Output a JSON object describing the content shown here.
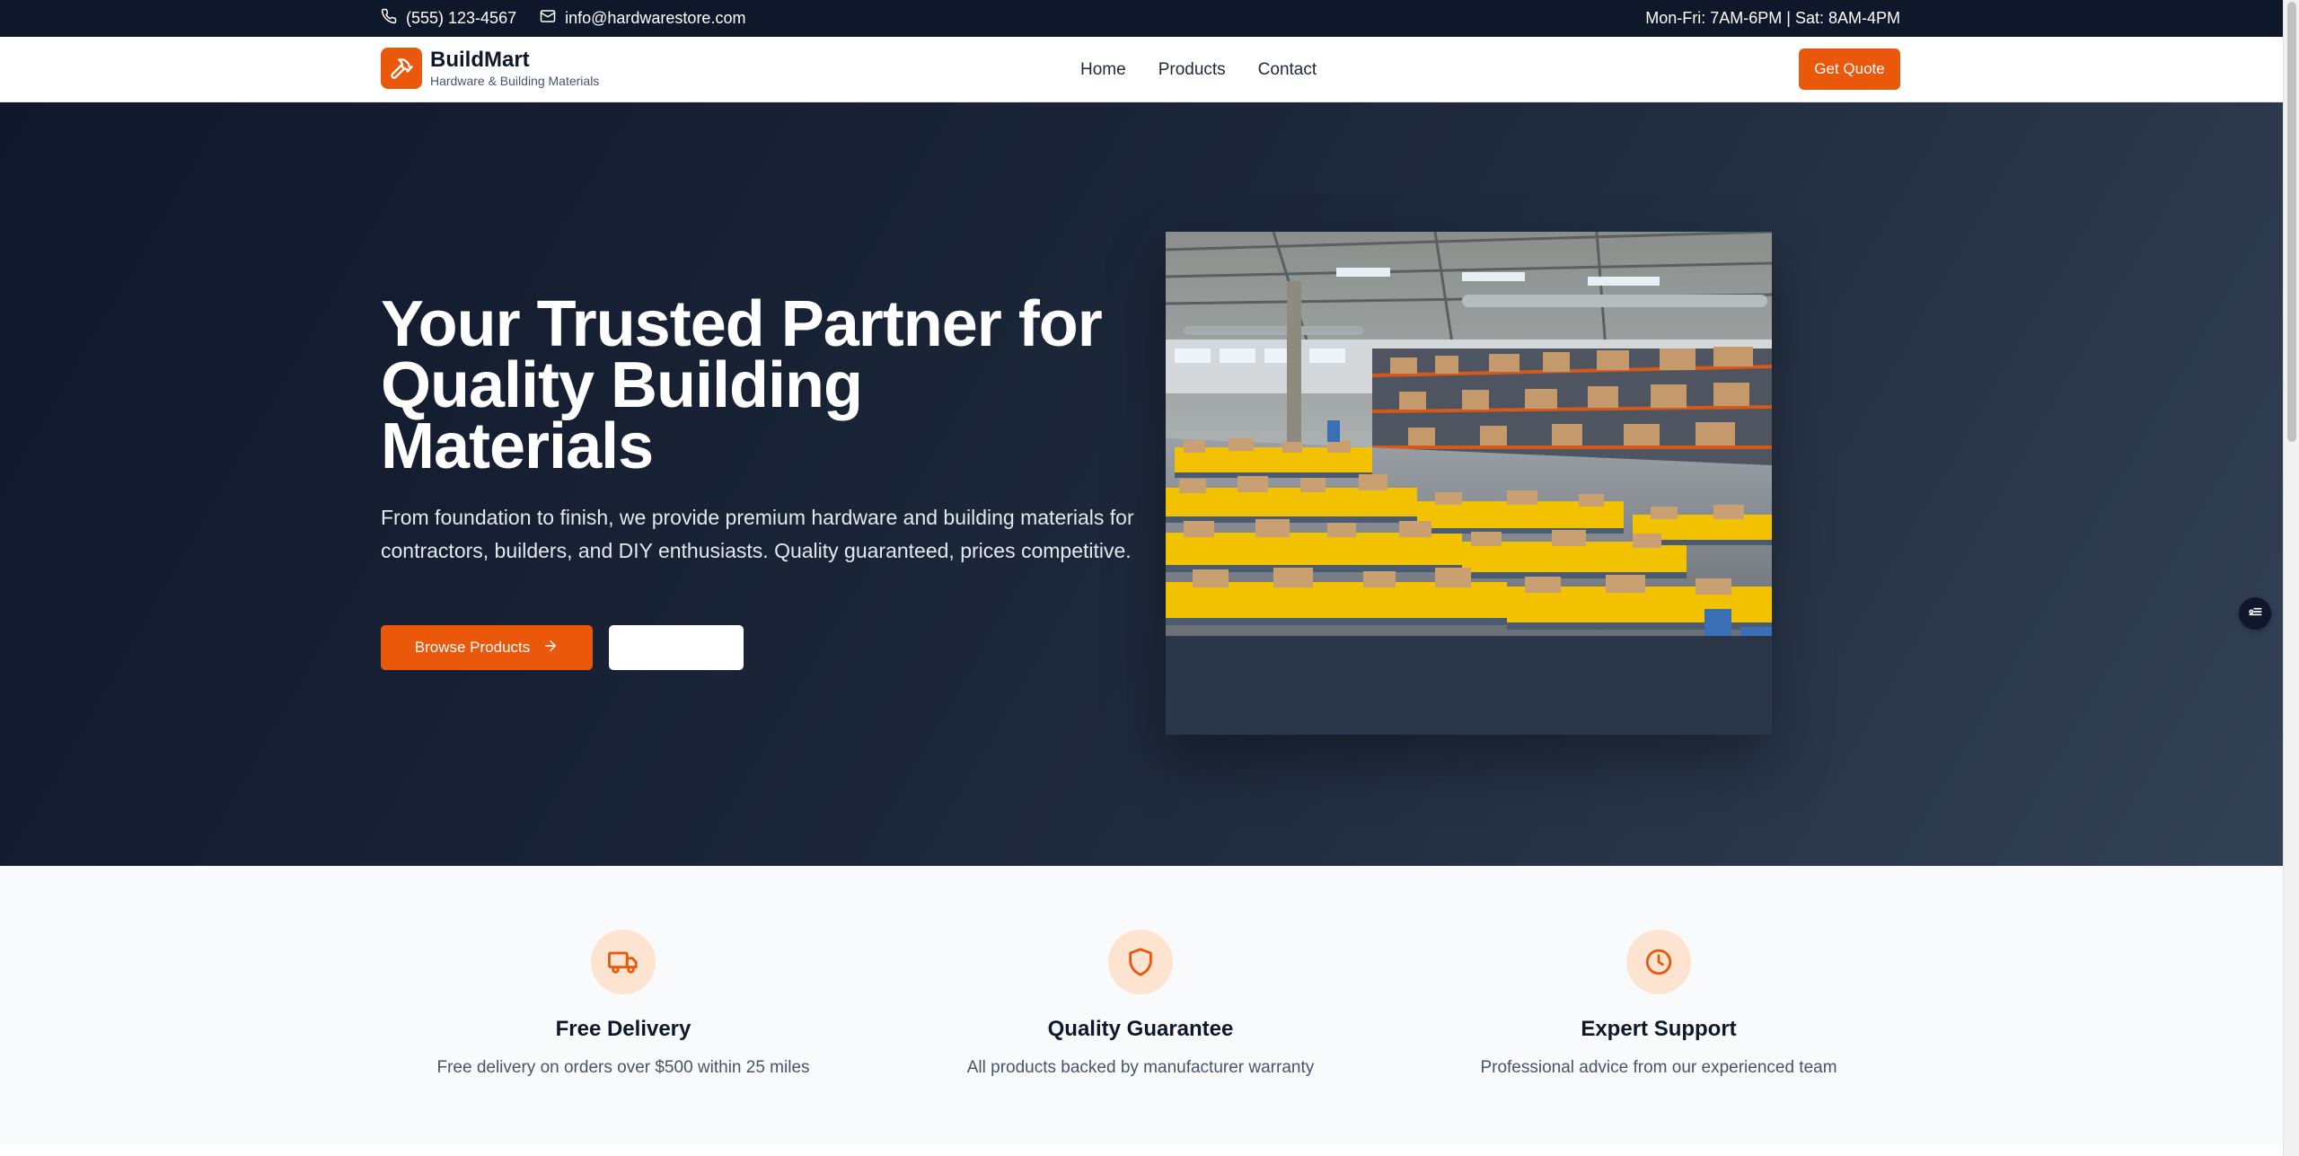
{
  "topbar": {
    "phone": "(555) 123-4567",
    "email": "info@hardwarestore.com",
    "hours": "Mon-Fri: 7AM-6PM | Sat: 8AM-4PM"
  },
  "nav": {
    "brand_name": "BuildMart",
    "brand_tagline": "Hardware & Building Materials",
    "links": [
      "Home",
      "Products",
      "Contact"
    ],
    "cta": "Get Quote"
  },
  "hero": {
    "title": "Your Trusted Partner for Quality Building Materials",
    "description": "From foundation to finish, we provide premium hardware and building materials for contractors, builders, and DIY enthusiasts. Quality guaranteed, prices competitive.",
    "primary_button": "Browse Products",
    "secondary_button": ""
  },
  "features": [
    {
      "icon": "truck-icon",
      "title": "Free Delivery",
      "description": "Free delivery on orders over $500 within 25 miles"
    },
    {
      "icon": "shield-icon",
      "title": "Quality Guarantee",
      "description": "All products backed by manufacturer warranty"
    },
    {
      "icon": "clock-icon",
      "title": "Expert Support",
      "description": "Professional advice from our experienced team"
    }
  ],
  "colors": {
    "accent": "#ea580c",
    "dark": "#0f172a",
    "accent_light": "#fde4d0"
  }
}
